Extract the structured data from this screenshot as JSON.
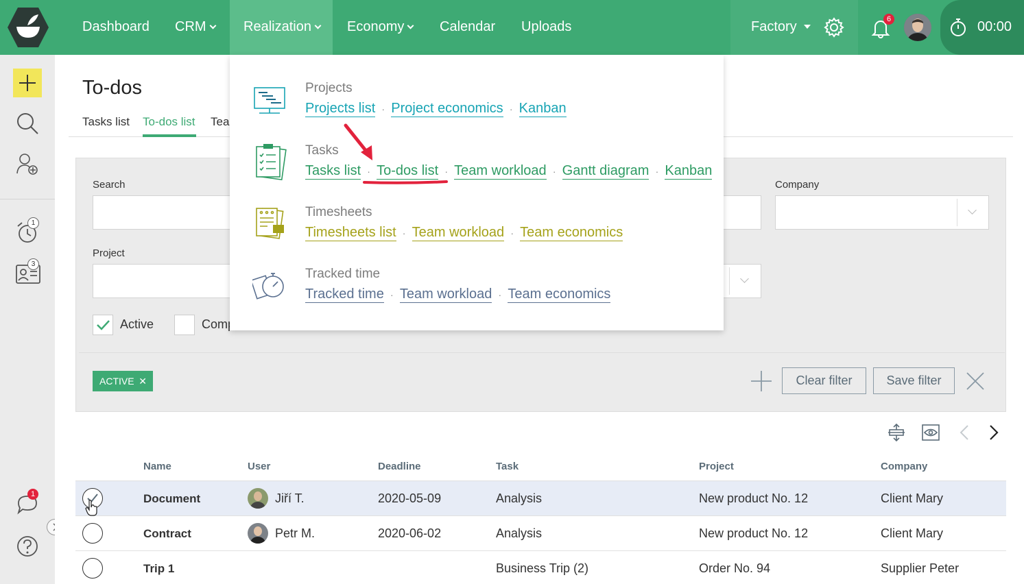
{
  "topbar": {
    "nav": [
      {
        "label": "Dashboard"
      },
      {
        "label": "CRM"
      },
      {
        "label": "Realization"
      },
      {
        "label": "Economy"
      },
      {
        "label": "Calendar"
      },
      {
        "label": "Uploads"
      }
    ],
    "company": "Factory",
    "notifications_count": "6",
    "timer": "00:00"
  },
  "sidebar": {
    "reminders_count": "1",
    "contacts_count": "3",
    "chat_count": "1"
  },
  "page": {
    "title": "To-dos",
    "tabs": [
      "Tasks list",
      "To-dos list",
      "Tear"
    ]
  },
  "filters": {
    "search_label": "Search",
    "company_label": "Company",
    "project_label": "Project",
    "checkboxes": [
      {
        "label": "Active",
        "checked": true
      },
      {
        "label": "Comp",
        "checked": false
      }
    ],
    "active_tag": "ACTIVE",
    "clear_label": "Clear filter",
    "save_label": "Save filter"
  },
  "table": {
    "columns": [
      "Name",
      "User",
      "Deadline",
      "Task",
      "Project",
      "Company"
    ],
    "rows": [
      {
        "name": "Document",
        "user": "Jiří T.",
        "deadline": "2020-05-09",
        "task": "Analysis",
        "project": "New product No. 12",
        "company": "Client Mary",
        "selected": true
      },
      {
        "name": "Contract",
        "user": "Petr M.",
        "deadline": "2020-06-02",
        "task": "Analysis",
        "project": "New product No. 12",
        "company": "Client Mary",
        "selected": false
      },
      {
        "name": "Trip 1",
        "user": "",
        "deadline": "",
        "task": "Business Trip (2)",
        "project": "Order No. 94",
        "company": "Supplier Peter",
        "selected": false
      }
    ]
  },
  "menu": {
    "sections": [
      {
        "title": "Projects",
        "links": [
          "Projects list",
          "Project economics",
          "Kanban"
        ],
        "color": "#17a4b4"
      },
      {
        "title": "Tasks",
        "links": [
          "Tasks list",
          "To-dos list",
          "Team workload",
          "Gantt diagram",
          "Kanban"
        ],
        "color": "#2e9b63"
      },
      {
        "title": "Timesheets",
        "links": [
          "Timesheets list",
          "Team workload",
          "Team economics"
        ],
        "color": "#a5a21a"
      },
      {
        "title": "Tracked time",
        "links": [
          "Tracked time",
          "Team workload",
          "Team economics"
        ],
        "color": "#5b7090"
      }
    ]
  },
  "colors": {
    "brand_green": "#3eaa74",
    "highlight_red": "#e2223c"
  }
}
